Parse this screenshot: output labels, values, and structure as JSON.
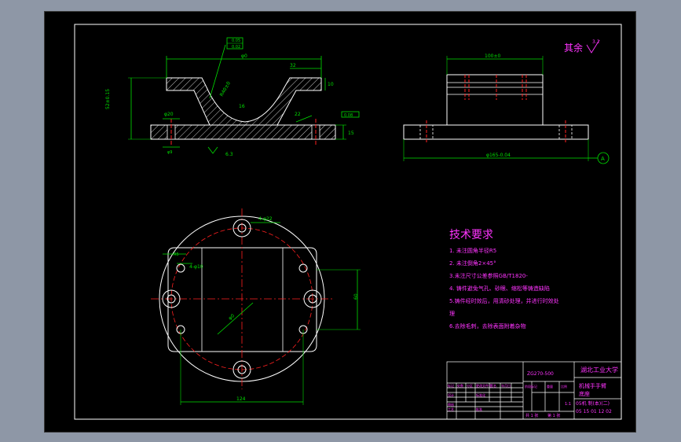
{
  "drawing": {
    "roughness_label": "其余",
    "roughness_value": "3.2",
    "front_view": {
      "tolerance_frame_top": "0.05",
      "tolerance_frame_bottom": "0.02",
      "width_dim": "φ0",
      "right_width_dim": "32",
      "height_dim_right": "10",
      "left_height_dim": "52±0.15",
      "bore_dim": "R40±0",
      "inner_dim": "16",
      "hole_dim": "φ20",
      "small_hole_dim": "φ9",
      "side_dim": "22",
      "base_height_dim": "15",
      "datum_box": "0.08",
      "surface_mark": "6.3"
    },
    "side_view": {
      "top_dim": "100±0",
      "bottom_dim": "φ165-0.04",
      "datum_label": "A"
    },
    "plan_view": {
      "hole_label_top": "4-φ22",
      "hole_label_left": "4-φ10",
      "radius_label": "R5",
      "pcd_label": "φ0",
      "height_dim": "60",
      "width_dim": "124"
    }
  },
  "tech_requirements": {
    "title": "技术要求",
    "items": [
      "1. 未注圆角半径R5",
      "2. 未注倒角2×45°",
      "3.未注尺寸公差参照GB/T1820-",
      "4. 铸件避免气孔、砂眼、缩松等铸造缺陷",
      "5.铸件经时效后，用清砂处理，并进行时效处",
      "理",
      "6.去除毛刺，去除表面附着杂物"
    ]
  },
  "title_block": {
    "school": "湖北工业大学",
    "material": "ZG270-500",
    "part_name_1": "机械手手臂",
    "part_name_2": "底座",
    "scale": "1:1",
    "drawing_no_1": "05机 制(本)(二)",
    "drawing_no_2": "05 15 01 12 02",
    "sheet_total": "共 1 张",
    "sheet_no": "第 1 张",
    "labels": [
      "标记",
      "处数",
      "分区",
      "更改文件号",
      "签名",
      "年月日",
      "设计",
      "标准化",
      "审核",
      "工艺",
      "批准",
      "阶段标记",
      "重量",
      "比例"
    ]
  },
  "colors": {
    "line": "#ffffff",
    "center": "#ff2020",
    "dimension": "#00e000",
    "annotation": "#ff33ff",
    "hatch": "#ffffff",
    "border": "#ffffff"
  }
}
